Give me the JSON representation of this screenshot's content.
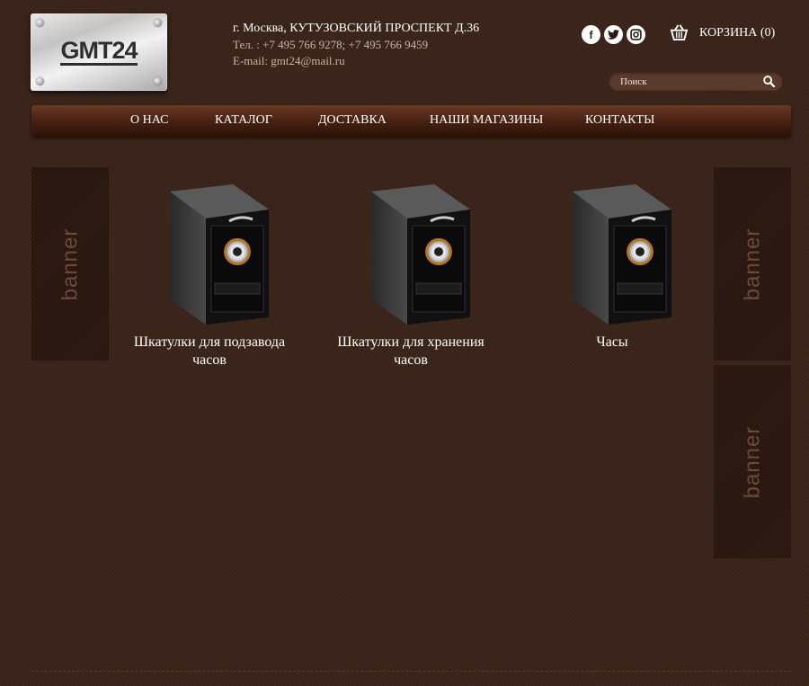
{
  "logo": {
    "text": "GMT24"
  },
  "contacts": {
    "address": "г. Москва, КУТУЗОВСКИЙ ПРОСПЕКТ Д.36",
    "phone": "Тел. : +7 495 766 9278; +7 495 766 9459",
    "email": "E-mail: gmt24@mail.ru"
  },
  "social": {
    "facebook": "f",
    "twitter": "t",
    "instagram": "in"
  },
  "cart": {
    "label": "КОРЗИНА (0)"
  },
  "search": {
    "placeholder": "Поиск"
  },
  "nav": {
    "items": [
      {
        "label": "О НАС"
      },
      {
        "label": "КАТАЛОГ"
      },
      {
        "label": "ДОСТАВКА"
      },
      {
        "label": "НАШИ МАГАЗИНЫ"
      },
      {
        "label": "КОНТАКТЫ"
      }
    ]
  },
  "banners": {
    "left": "banner",
    "right_top": "banner",
    "right_bottom": "banner"
  },
  "products": [
    {
      "title": "Шкатулки для подзавода часов"
    },
    {
      "title": "Шкатулки для хранения часов"
    },
    {
      "title": "Часы"
    }
  ]
}
